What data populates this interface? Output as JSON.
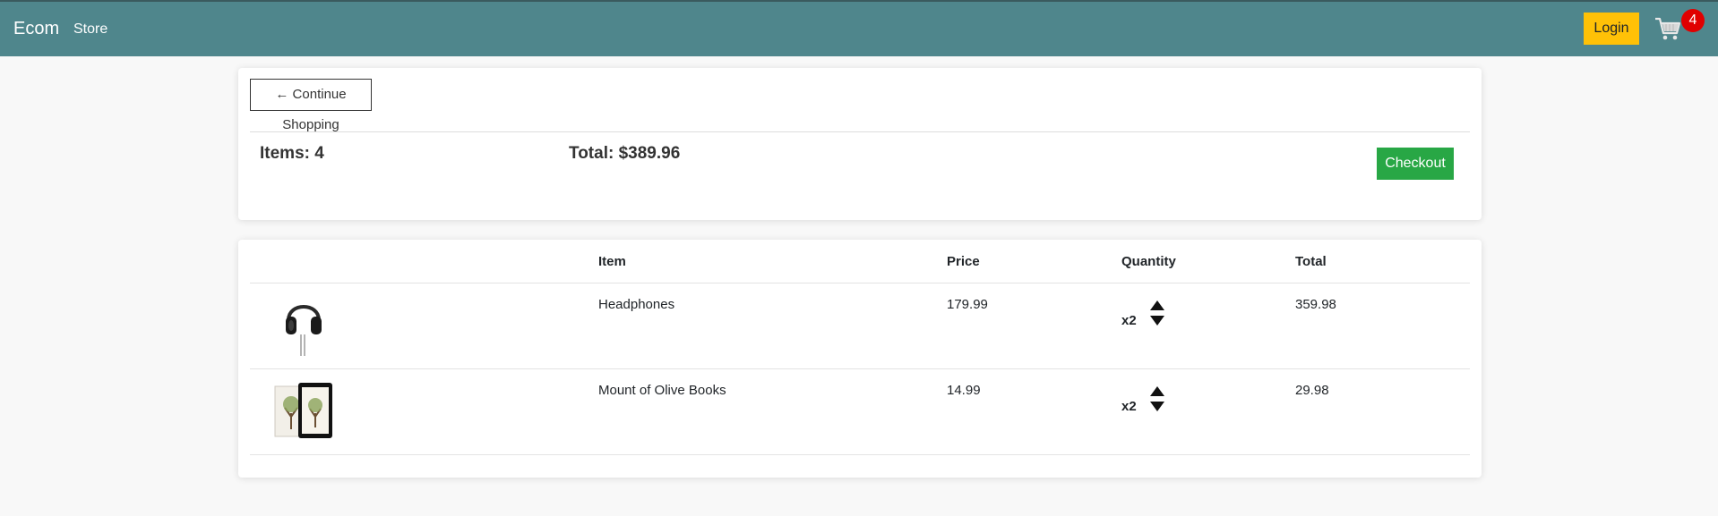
{
  "navbar": {
    "brand": "Ecom",
    "store_link": "Store",
    "login_label": "Login",
    "cart_count": "4",
    "cart_icon": "cart-icon",
    "bg_color": "#4f868c"
  },
  "summary": {
    "continue_label": "← Continue Shopping",
    "items_text": "Items: 4",
    "total_text": "Total: $389.96",
    "checkout_label": "Checkout"
  },
  "table": {
    "headers": [
      "",
      "Item",
      "Price",
      "Quantity",
      "Total"
    ],
    "rows": [
      {
        "image": "headphones-image",
        "item": "Headphones",
        "price": "179.99",
        "quantity": "x2",
        "total": "359.98"
      },
      {
        "image": "book-image",
        "item": "Mount of Olive Books",
        "price": "14.99",
        "quantity": "x2",
        "total": "29.98"
      }
    ]
  },
  "colors": {
    "login": "#ffc107",
    "checkout": "#28a745",
    "badge": "#e00000"
  }
}
